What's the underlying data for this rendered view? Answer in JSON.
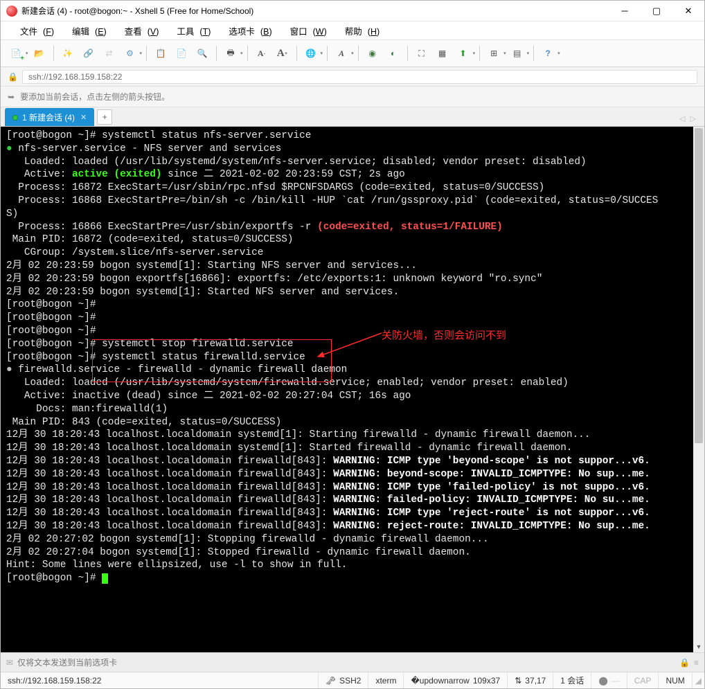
{
  "window": {
    "title": "新建会话 (4) - root@bogon:~ - Xshell 5 (Free for Home/School)"
  },
  "menu": {
    "file": "文件",
    "file_u": "F",
    "edit": "编辑",
    "edit_u": "E",
    "view": "查看",
    "view_u": "V",
    "tools": "工具",
    "tools_u": "T",
    "tabs": "选项卡",
    "tabs_u": "B",
    "window": "窗口",
    "window_u": "W",
    "help": "帮助",
    "help_u": "H"
  },
  "toolbar_icons": [
    "new",
    "open",
    "wand",
    "link",
    "unlink",
    "gear",
    "copy",
    "paste",
    "search",
    "printer",
    "font-dec",
    "font-inc",
    "globe",
    "font-style",
    "palette",
    "swap",
    "fullscreen",
    "layout",
    "arrow",
    "box",
    "layers",
    "help-q"
  ],
  "address": {
    "url": "ssh://192.168.159.158:22"
  },
  "sessionbar": {
    "hint": "要添加当前会话，点击左侧的箭头按钮。"
  },
  "tabs": {
    "active_label": "1 新建会话 (4)"
  },
  "annotation": {
    "text": "关防火墙，否则会访问不到"
  },
  "terminal": {
    "lines": [
      {
        "segs": [
          {
            "t": "[root@bogon ~]# systemctl status nfs-server.service"
          }
        ]
      },
      {
        "cls": "bullet-g",
        "segs": [
          {
            "t": "nfs-server.service - NFS server and services"
          }
        ]
      },
      {
        "segs": [
          {
            "t": "   Loaded: loaded (/usr/lib/systemd/system/nfs-server.service; disabled; vendor preset: disabled)"
          }
        ]
      },
      {
        "segs": [
          {
            "t": "   Active: "
          },
          {
            "t": "active (exited)",
            "c": "c-bgreen"
          },
          {
            "t": " since 二 2021-02-02 20:23:59 CST; 2s ago"
          }
        ]
      },
      {
        "segs": [
          {
            "t": "  Process: 16872 ExecStart=/usr/sbin/rpc.nfsd $RPCNFSDARGS (code=exited, status=0/SUCCESS)"
          }
        ]
      },
      {
        "segs": [
          {
            "t": "  Process: 16868 ExecStartPre=/bin/sh -c /bin/kill -HUP `cat /run/gssproxy.pid` (code=exited, status=0/SUCCES"
          }
        ]
      },
      {
        "segs": [
          {
            "t": "S)"
          }
        ]
      },
      {
        "segs": [
          {
            "t": "  Process: 16866 ExecStartPre=/usr/sbin/exportfs -r "
          },
          {
            "t": "(code=exited, status=1/FAILURE)",
            "c": "c-red"
          }
        ]
      },
      {
        "segs": [
          {
            "t": " Main PID: 16872 (code=exited, status=0/SUCCESS)"
          }
        ]
      },
      {
        "segs": [
          {
            "t": "   CGroup: /system.slice/nfs-server.service"
          }
        ]
      },
      {
        "segs": [
          {
            "t": ""
          }
        ]
      },
      {
        "segs": [
          {
            "t": "2月 02 20:23:59 bogon systemd[1]: Starting NFS server and services..."
          }
        ]
      },
      {
        "segs": [
          {
            "t": "2月 02 20:23:59 bogon exportfs[16866]: exportfs: /etc/exports:1: unknown keyword \"ro.sync\""
          }
        ]
      },
      {
        "segs": [
          {
            "t": "2月 02 20:23:59 bogon systemd[1]: Started NFS server and services."
          }
        ]
      },
      {
        "segs": [
          {
            "t": "[root@bogon ~]# "
          }
        ]
      },
      {
        "segs": [
          {
            "t": "[root@bogon ~]# "
          }
        ]
      },
      {
        "segs": [
          {
            "t": "[root@bogon ~]# "
          }
        ]
      },
      {
        "segs": [
          {
            "t": "[root@bogon ~]# systemctl stop firewalld.service"
          }
        ]
      },
      {
        "segs": [
          {
            "t": "[root@bogon ~]# systemctl status firewalld.service"
          }
        ]
      },
      {
        "cls": "bullet-w",
        "segs": [
          {
            "t": "firewalld.service - firewalld - dynamic firewall daemon"
          }
        ]
      },
      {
        "segs": [
          {
            "t": "   Loaded: loaded (/usr/lib/systemd/system/firewalld.service; enabled; vendor preset: enabled)"
          }
        ]
      },
      {
        "segs": [
          {
            "t": "   Active: inactive (dead) since 二 2021-02-02 20:27:04 CST; 16s ago"
          }
        ]
      },
      {
        "segs": [
          {
            "t": "     Docs: man:firewalld(1)"
          }
        ]
      },
      {
        "segs": [
          {
            "t": " Main PID: 843 (code=exited, status=0/SUCCESS)"
          }
        ]
      },
      {
        "segs": [
          {
            "t": ""
          }
        ]
      },
      {
        "segs": [
          {
            "t": "12月 30 18:20:43 localhost.localdomain systemd[1]: Starting firewalld - dynamic firewall daemon..."
          }
        ]
      },
      {
        "segs": [
          {
            "t": "12月 30 18:20:43 localhost.localdomain systemd[1]: Started firewalld - dynamic firewall daemon."
          }
        ]
      },
      {
        "segs": [
          {
            "t": "12月 30 18:20:43 localhost.localdomain firewalld[843]: "
          },
          {
            "t": "WARNING: ICMP type 'beyond-scope' is not suppor...v6.",
            "c": "c-white"
          }
        ]
      },
      {
        "segs": [
          {
            "t": "12月 30 18:20:43 localhost.localdomain firewalld[843]: "
          },
          {
            "t": "WARNING: beyond-scope: INVALID_ICMPTYPE: No sup...me.",
            "c": "c-white"
          }
        ]
      },
      {
        "segs": [
          {
            "t": "12月 30 18:20:43 localhost.localdomain firewalld[843]: "
          },
          {
            "t": "WARNING: ICMP type 'failed-policy' is not suppo...v6.",
            "c": "c-white"
          }
        ]
      },
      {
        "segs": [
          {
            "t": "12月 30 18:20:43 localhost.localdomain firewalld[843]: "
          },
          {
            "t": "WARNING: failed-policy: INVALID_ICMPTYPE: No su...me.",
            "c": "c-white"
          }
        ]
      },
      {
        "segs": [
          {
            "t": "12月 30 18:20:43 localhost.localdomain firewalld[843]: "
          },
          {
            "t": "WARNING: ICMP type 'reject-route' is not suppor...v6.",
            "c": "c-white"
          }
        ]
      },
      {
        "segs": [
          {
            "t": "12月 30 18:20:43 localhost.localdomain firewalld[843]: "
          },
          {
            "t": "WARNING: reject-route: INVALID_ICMPTYPE: No sup...me.",
            "c": "c-white"
          }
        ]
      },
      {
        "segs": [
          {
            "t": "2月 02 20:27:02 bogon systemd[1]: Stopping firewalld - dynamic firewall daemon..."
          }
        ]
      },
      {
        "segs": [
          {
            "t": "2月 02 20:27:04 bogon systemd[1]: Stopped firewalld - dynamic firewall daemon."
          }
        ]
      },
      {
        "segs": [
          {
            "t": "Hint: Some lines were ellipsized, use -l to show in full."
          }
        ]
      },
      {
        "segs": [
          {
            "t": "[root@bogon ~]# "
          }
        ],
        "cursor": true
      }
    ]
  },
  "sendbar": {
    "placeholder": "仅将文本发送到当前选项卡"
  },
  "status": {
    "conn": "ssh://192.168.159.158:22",
    "ssh": "SSH2",
    "term": "xterm",
    "size": "109x37",
    "pos": "37,17",
    "sess": "1 会话",
    "cap": "CAP",
    "num": "NUM",
    "arrows": "⇅"
  }
}
